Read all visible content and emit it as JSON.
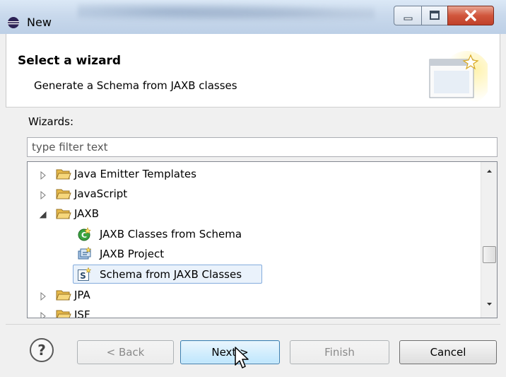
{
  "window": {
    "title": "New"
  },
  "banner": {
    "title": "Select a wizard",
    "description": "Generate a Schema from JAXB classes"
  },
  "wizards_label": "Wizards:",
  "filter": {
    "value": "",
    "placeholder": "type filter text"
  },
  "tree": {
    "items": [
      {
        "label": "Java Emitter Templates",
        "expanded": false,
        "icon": "folder-icon"
      },
      {
        "label": "JavaScript",
        "expanded": false,
        "icon": "folder-icon"
      },
      {
        "label": "JAXB",
        "expanded": true,
        "icon": "folder-icon"
      },
      {
        "label": "JAXB Classes from Schema",
        "icon": "jaxb-classes-icon"
      },
      {
        "label": "JAXB Project",
        "icon": "jaxb-project-icon"
      },
      {
        "label": "Schema from JAXB Classes",
        "icon": "schema-icon",
        "selected": true
      },
      {
        "label": "JPA",
        "expanded": false,
        "icon": "folder-icon"
      },
      {
        "label": "JSF",
        "expanded": false,
        "icon": "folder-icon"
      }
    ]
  },
  "buttons": {
    "back": "< Back",
    "next": "Next >",
    "finish": "Finish",
    "cancel": "Cancel"
  },
  "colors": {
    "selection": "#eaf2fb",
    "close_button": "#c9462c",
    "folder": "#e9c46a"
  }
}
